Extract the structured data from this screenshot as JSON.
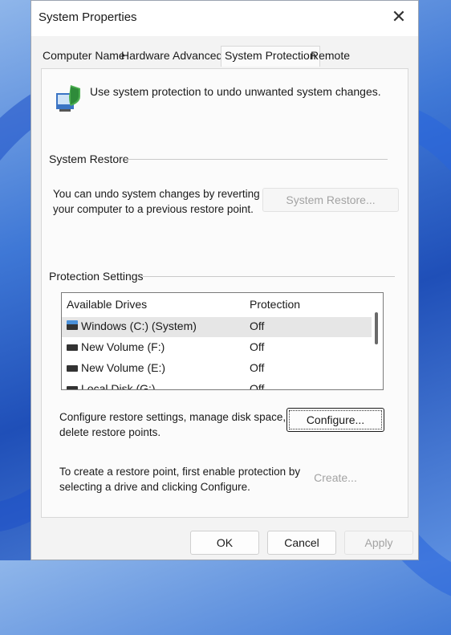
{
  "window": {
    "title": "System Properties",
    "close_glyph": "✕"
  },
  "tabs": [
    {
      "label": "Computer Name",
      "active": false
    },
    {
      "label": "Hardware",
      "active": false
    },
    {
      "label": "Advanced",
      "active": false
    },
    {
      "label": "System Protection",
      "active": true
    },
    {
      "label": "Remote",
      "active": false
    }
  ],
  "intro": {
    "icon": "system-protection-icon",
    "text": "Use system protection to undo unwanted system changes."
  },
  "system_restore": {
    "group_label": "System Restore",
    "description_line1": "You can undo system changes by reverting",
    "description_line2": "your computer to a previous restore point.",
    "button_label": "System Restore...",
    "button_enabled": false
  },
  "protection_settings": {
    "group_label": "Protection Settings",
    "columns": [
      "Available Drives",
      "Protection"
    ],
    "drives": [
      {
        "name": "Windows (C:) (System)",
        "protection": "Off",
        "icon": "system-drive-icon",
        "selected": true
      },
      {
        "name": "New Volume (F:)",
        "protection": "Off",
        "icon": "drive-icon",
        "selected": false
      },
      {
        "name": "New Volume (E:)",
        "protection": "Off",
        "icon": "drive-icon",
        "selected": false
      },
      {
        "name": "Local Disk (G:)",
        "protection": "Off",
        "icon": "drive-icon",
        "selected": false
      }
    ]
  },
  "configure": {
    "description_line1": "Configure restore settings, manage disk space, and",
    "description_line2": "delete restore points.",
    "button_label": "Configure..."
  },
  "create": {
    "description_line1": "To create a restore point, first enable protection by",
    "description_line2": "selecting a drive and clicking Configure.",
    "button_label": "Create...",
    "button_enabled": false
  },
  "footer": {
    "ok_label": "OK",
    "cancel_label": "Cancel",
    "apply_label": "Apply"
  },
  "colors": {
    "window_bg": "#f3f3f3",
    "selected_row": "#e6e6e6",
    "disabled_text": "#a3a3a3"
  }
}
